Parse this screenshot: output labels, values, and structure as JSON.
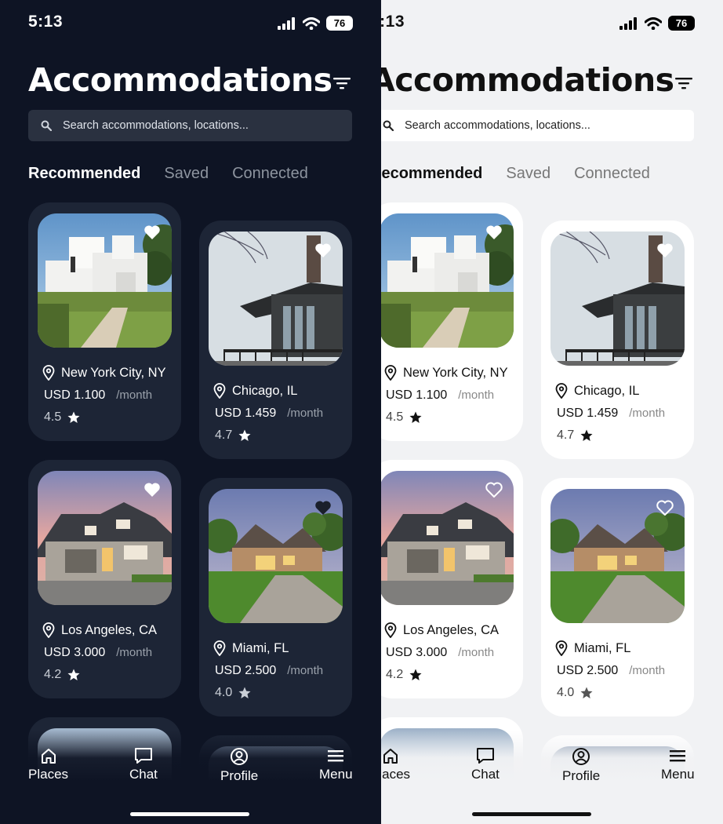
{
  "status": {
    "time": "5:13",
    "battery": "76"
  },
  "page": {
    "title": "Accommodations"
  },
  "search": {
    "placeholder": "Search accommodations, locations..."
  },
  "tabs": [
    {
      "label": "Recommended",
      "active": true
    },
    {
      "label": "Saved",
      "active": false
    },
    {
      "label": "Connected",
      "active": false
    }
  ],
  "listings": [
    {
      "location": "New York City, NY",
      "price": "USD 1.100",
      "period": "/month",
      "rating": "4.5",
      "image": "modern-white-house"
    },
    {
      "location": "Chicago, IL",
      "price": "USD 1.459",
      "period": "/month",
      "rating": "4.7",
      "image": "modern-dark-house"
    },
    {
      "location": "Los Angeles, CA",
      "price": "USD 3.000",
      "period": "/month",
      "rating": "4.2",
      "image": "craftsman-house-sunset"
    },
    {
      "location": "Miami, FL",
      "price": "USD 2.500",
      "period": "/month",
      "rating": "4.0",
      "image": "stone-house-driveway"
    }
  ],
  "nav": [
    {
      "label": "Places",
      "icon": "home-icon"
    },
    {
      "label": "Chat",
      "icon": "chat-icon"
    },
    {
      "label": "Profile",
      "icon": "profile-icon"
    },
    {
      "label": "Menu",
      "icon": "menu-icon"
    }
  ],
  "themes": {
    "dark_bg": "#0e1424",
    "dark_card": "#1d2536",
    "light_bg": "#f1f2f4",
    "light_card": "#ffffff"
  }
}
